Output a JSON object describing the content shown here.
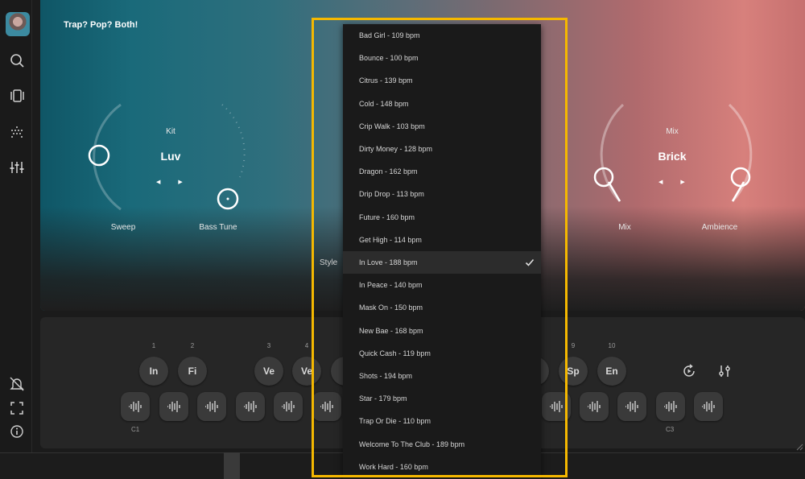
{
  "app": {
    "title": "Trap? Pop? Both!"
  },
  "sidebar": {
    "icons": [
      "avatar",
      "search-icon",
      "library-icon",
      "grid-dots-icon",
      "sliders-icon",
      "bell-off-icon",
      "fullscreen-icon",
      "info-icon"
    ]
  },
  "kit": {
    "label": "Kit",
    "value": "Luv",
    "knob_left_label": "Sweep",
    "knob_right_label": "Bass Tune"
  },
  "mix": {
    "label": "Mix",
    "value": "Brick",
    "knob_left_label": "Mix",
    "knob_right_label": "Ambience"
  },
  "style": {
    "label": "Style",
    "selected": "In Love - 188 bpm",
    "options": [
      "Bad Girl - 109 bpm",
      "Bounce - 100 bpm",
      "Citrus - 139 bpm",
      "Cold - 148 bpm",
      "Crip Walk - 103 bpm",
      "Dirty Money - 128 bpm",
      "Dragon - 162 bpm",
      "Drip Drop - 113 bpm",
      "Future - 160 bpm",
      "Get High - 114 bpm",
      "In Love - 188 bpm",
      "In Peace - 140 bpm",
      "Mask On - 150 bpm",
      "New Bae - 168 bpm",
      "Quick Cash - 119 bpm",
      "Shots - 194 bpm",
      "Star - 179 bpm",
      "Trap Or Die - 110 bpm",
      "Welcome To The Club - 189 bpm",
      "Work Hard - 160 bpm"
    ]
  },
  "pads": {
    "left": [
      {
        "num": "1",
        "label": "In"
      },
      {
        "num": "2",
        "label": "Fi"
      },
      {
        "num": "3",
        "label": "Ve"
      },
      {
        "num": "4",
        "label": "Ve"
      }
    ],
    "right": [
      {
        "num": "9",
        "label": "Sp"
      },
      {
        "num": "10",
        "label": "En"
      }
    ],
    "left_chord_label": "C1",
    "right_chord_label": "C3"
  },
  "colors": {
    "highlight": "#f5b800",
    "teal": "#0f5666",
    "salmon": "#d7807c"
  }
}
